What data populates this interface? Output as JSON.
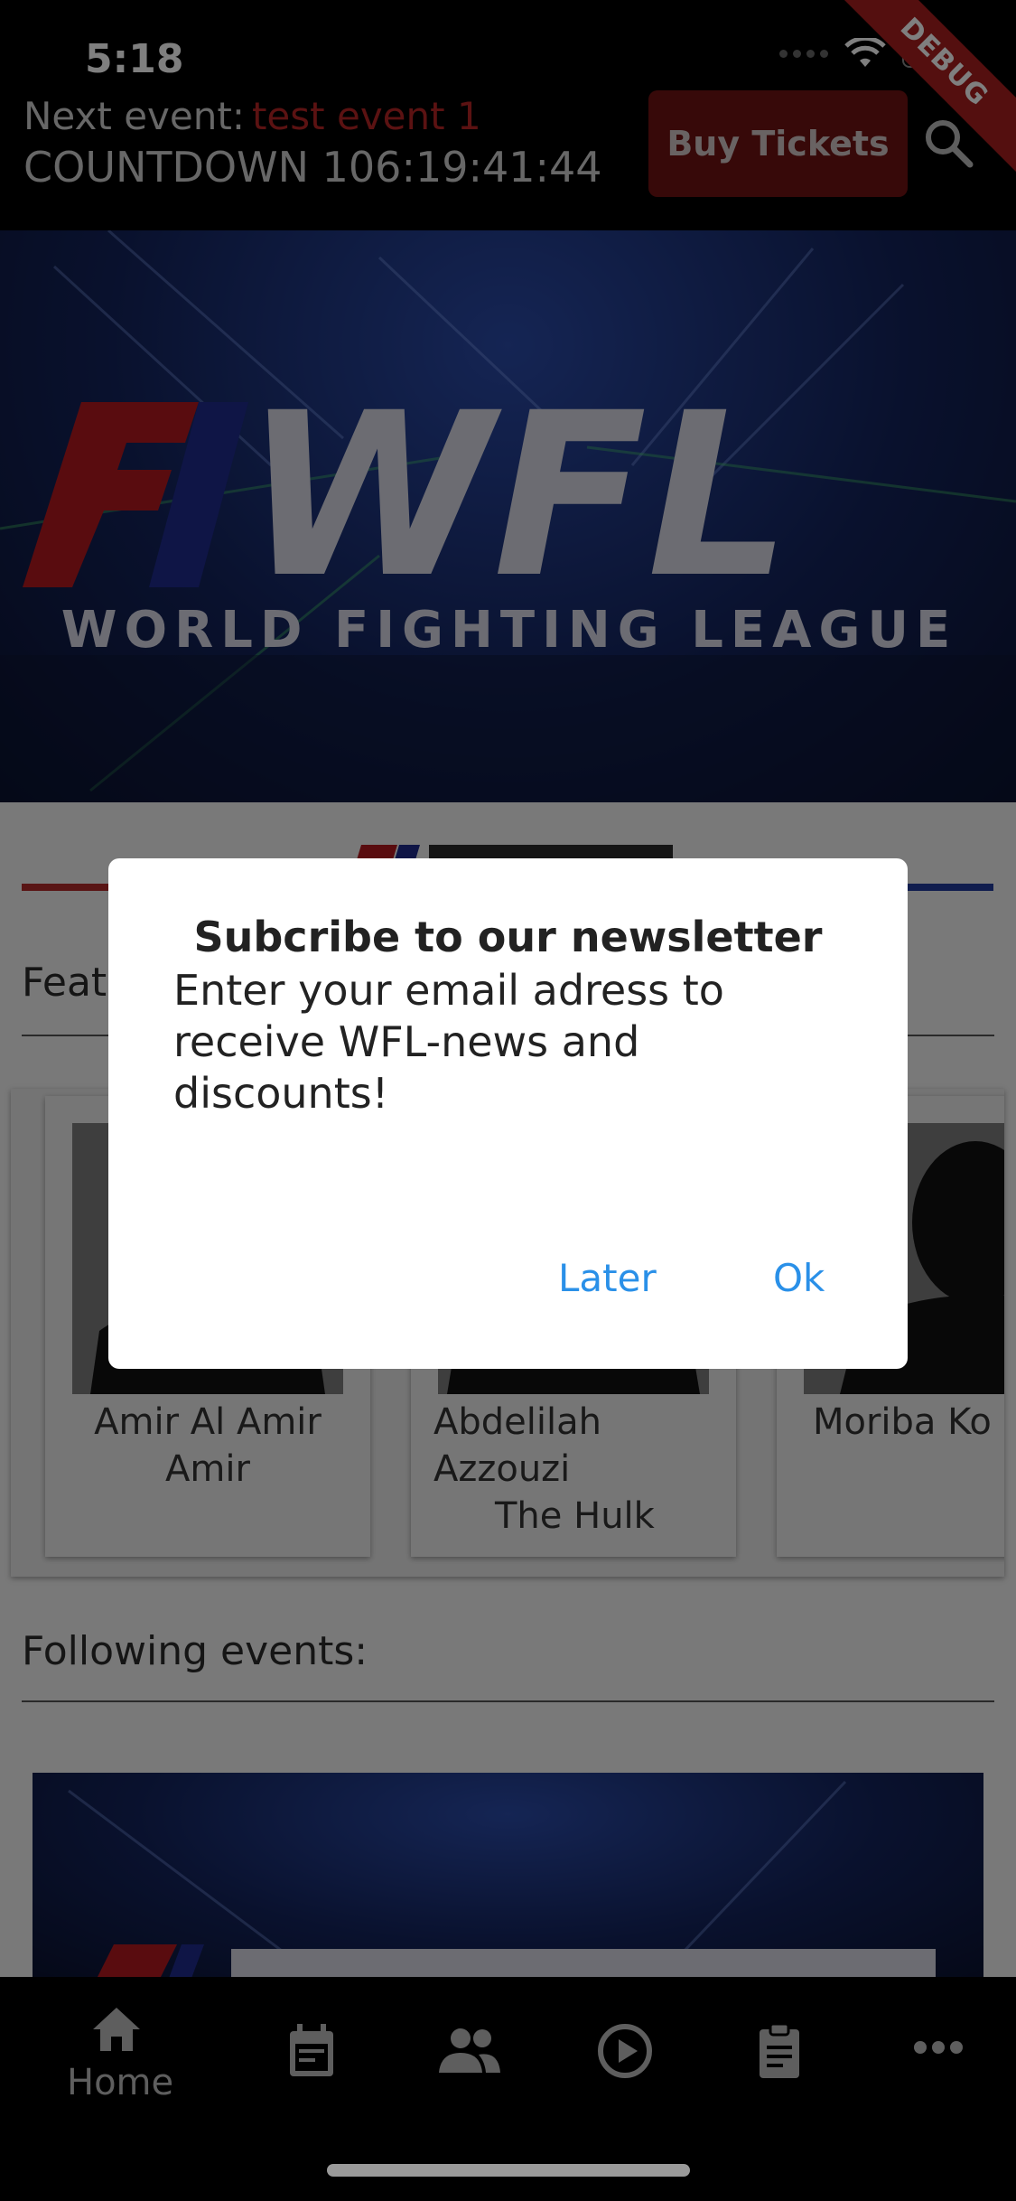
{
  "status_bar": {
    "time": "5:18",
    "debug_label": "DEBUG"
  },
  "header": {
    "next_event_label": "Next event:",
    "next_event_name": "test event 1",
    "countdown": "COUNTDOWN 106:19:41:44",
    "buy_tickets_label": "Buy Tickets",
    "accent_color": "#b62424"
  },
  "hero": {
    "logo_text": "WFL",
    "subtitle": "WORLD FIGHTING LEAGUE"
  },
  "featured": {
    "title_partial": "Feat",
    "fighters": [
      {
        "name": "Amir Al Amir Amir"
      },
      {
        "name": "Abdelilah Azzouzi",
        "nickname": "The Hulk"
      },
      {
        "name": "Moriba Ko"
      }
    ]
  },
  "following": {
    "title": "Following events:"
  },
  "dialog": {
    "title": "Subcribe to our newsletter",
    "body": "Enter your email adress to receive WFL-news and discounts!",
    "later_label": "Later",
    "ok_label": "Ok",
    "button_color": "#2a90e8"
  },
  "bottom_nav": {
    "items": [
      {
        "icon": "home-icon",
        "label": "Home"
      },
      {
        "icon": "calendar-icon",
        "label": ""
      },
      {
        "icon": "people-icon",
        "label": ""
      },
      {
        "icon": "play-icon",
        "label": ""
      },
      {
        "icon": "clipboard-icon",
        "label": ""
      },
      {
        "icon": "more-icon",
        "label": ""
      }
    ]
  }
}
